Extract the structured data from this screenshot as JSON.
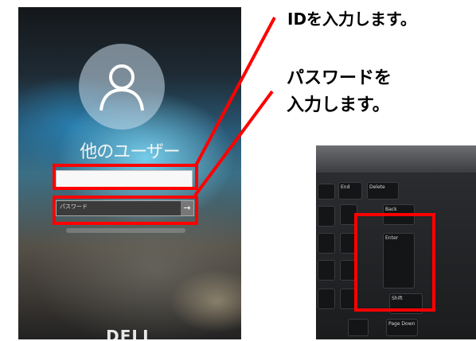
{
  "login_screen": {
    "user_name": "他のユーザー",
    "password_placeholder": "パスワード",
    "submit_arrow": "→",
    "brand": "DELL"
  },
  "callouts": {
    "id_label": "IDを入力します。",
    "password_label_line1": "パスワードを",
    "password_label_line2": "入力します。"
  },
  "keyboard": {
    "keys": {
      "end": "End",
      "delete": "Delete",
      "back": "Back",
      "enter": "Enter",
      "shift": "Shift",
      "page_down": "Page Down"
    }
  },
  "colors": {
    "highlight": "#ff0000",
    "callout_text": "#000000"
  }
}
